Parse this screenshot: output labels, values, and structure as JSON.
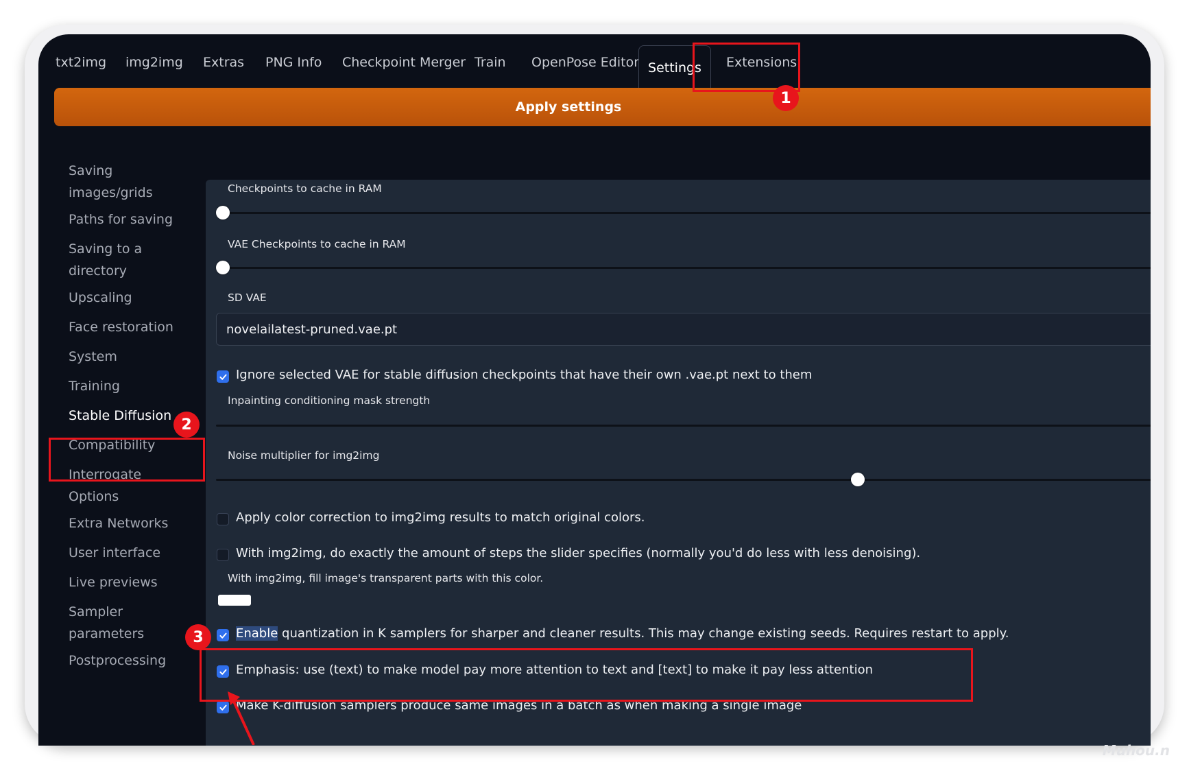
{
  "tabs": [
    "txt2img",
    "img2img",
    "Extras",
    "PNG Info",
    "Checkpoint Merger",
    "Train",
    "OpenPose Editor",
    "Settings",
    "Extensions"
  ],
  "active_tab": "Settings",
  "apply_button": "Apply settings",
  "sidebar": {
    "items": [
      {
        "line1": "Saving",
        "line2": "images/grids"
      },
      {
        "line1": "Paths for saving",
        "line2": ""
      },
      {
        "line1": "Saving to a",
        "line2": "directory"
      },
      {
        "line1": "Upscaling",
        "line2": ""
      },
      {
        "line1": "Face restoration",
        "line2": ""
      },
      {
        "line1": "System",
        "line2": ""
      },
      {
        "line1": "Training",
        "line2": ""
      },
      {
        "line1": "Stable Diffusion",
        "line2": ""
      },
      {
        "line1": "Compatibility",
        "line2": ""
      },
      {
        "line1": "Interrogate",
        "line2": "Options"
      },
      {
        "line1": "Extra Networks",
        "line2": ""
      },
      {
        "line1": "User interface",
        "line2": ""
      },
      {
        "line1": "Live previews",
        "line2": ""
      },
      {
        "line1": "Sampler",
        "line2": "parameters"
      },
      {
        "line1": "Postprocessing",
        "line2": ""
      }
    ],
    "active": "Stable Diffusion"
  },
  "settings": {
    "checkpoints_cache_label": "Checkpoints to cache in RAM",
    "checkpoints_cache_value": 0,
    "vae_cache_label": "VAE Checkpoints to cache in RAM",
    "vae_cache_value": 0,
    "sd_vae_label": "SD VAE",
    "sd_vae_value": "novelailatest-pruned.vae.pt",
    "ignore_vae_label": "Ignore selected VAE for stable diffusion checkpoints that have their own .vae.pt next to them",
    "ignore_vae_checked": true,
    "inpainting_mask_label": "Inpainting conditioning mask strength",
    "noise_multiplier_label": "Noise multiplier for img2img",
    "noise_multiplier_fraction": 0.75,
    "color_correction_label": "Apply color correction to img2img results to match original colors.",
    "color_correction_checked": false,
    "exact_steps_label": "With img2img, do exactly the amount of steps the slider specifies (normally you'd do less with less denoising).",
    "exact_steps_checked": false,
    "fill_color_label": "With img2img, fill image's transparent parts with this color.",
    "fill_color": "#ffffff",
    "quantization_highlight": "Enable",
    "quantization_rest": " quantization in K samplers for sharper and cleaner results. This may change existing seeds. Requires restart to apply.",
    "quantization_checked": true,
    "emphasis_label": "Emphasis: use (text) to make model pay more attention to text and [text] to make it pay less attention",
    "emphasis_checked": true,
    "batch_cond_label": "Make K-diffusion samplers produce same images in a batch as when making a single image",
    "batch_cond_checked": true
  },
  "annotations": [
    "1",
    "2",
    "3"
  ],
  "watermark": "Muhou.n",
  "colors": {
    "accent_orange": "#c85a0b",
    "annotation_red": "#e8151c",
    "checkbox_blue": "#2f6fec",
    "background": "#0b0f19",
    "panel": "#1f2937"
  }
}
